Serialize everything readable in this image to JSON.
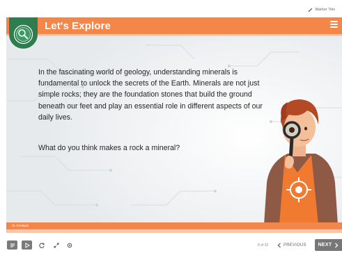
{
  "topbar": {
    "marker_tools_label": "Marker Tols"
  },
  "slide": {
    "title": "Let's Explore",
    "paragraph": "In the fascinating world of geology, understanding minerals is fundamental to unlock the secrets of the Earth. Minerals are not just simple rocks; they are the foundation stones that build the ground beneath our feet and play an essential role in different aspects of our daily lives.",
    "question": "What do you think makes a rock a mineral?",
    "footer_label": "St. Emelyas"
  },
  "controls": {
    "page_indicator": "8 of 32",
    "previous_label": "PREVIOUS",
    "next_label": "NEXT"
  },
  "colors": {
    "accent": "#f4864a",
    "accent_light": "#f9c6a8",
    "logo_green": "#2e7d4f",
    "button_gray": "#777777"
  },
  "icons": [
    "marker-icon",
    "menu-icon",
    "logo-icon",
    "transcript-icon",
    "play-icon",
    "replay-icon",
    "fullscreen-icon",
    "audio-icon",
    "chevron-left-icon",
    "chevron-right-icon",
    "magnifier-icon"
  ]
}
